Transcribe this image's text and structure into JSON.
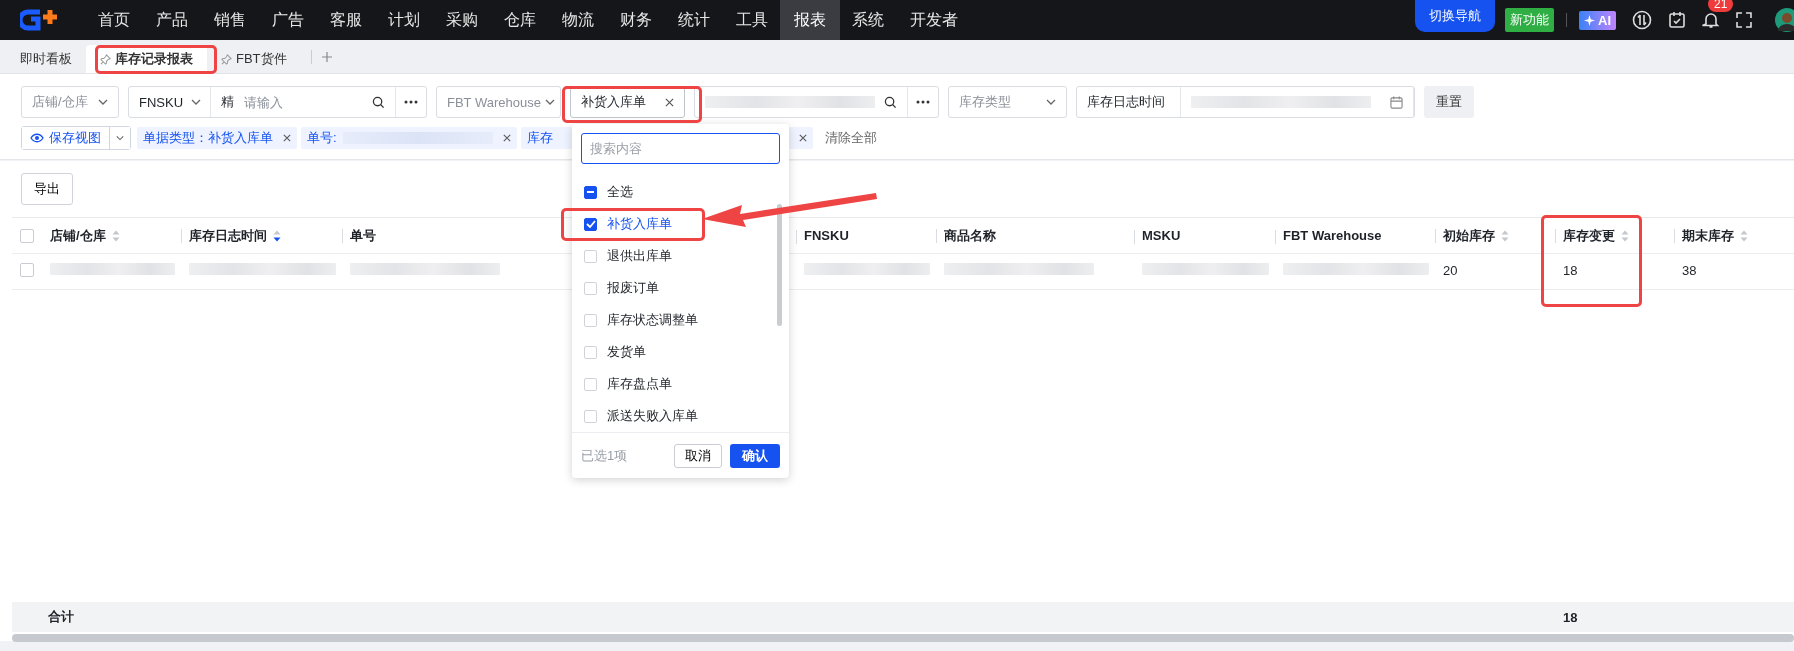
{
  "top_nav": {
    "items": [
      {
        "label": "首页",
        "selected": false
      },
      {
        "label": "产品",
        "selected": false
      },
      {
        "label": "销售",
        "selected": false
      },
      {
        "label": "广告",
        "selected": false
      },
      {
        "label": "客服",
        "selected": false
      },
      {
        "label": "计划",
        "selected": false
      },
      {
        "label": "采购",
        "selected": false
      },
      {
        "label": "仓库",
        "selected": false
      },
      {
        "label": "物流",
        "selected": false
      },
      {
        "label": "财务",
        "selected": false
      },
      {
        "label": "统计",
        "selected": false
      },
      {
        "label": "工具",
        "selected": false
      },
      {
        "label": "报表",
        "selected": true
      },
      {
        "label": "系统",
        "selected": false
      },
      {
        "label": "开发者",
        "selected": false
      }
    ],
    "switch_nav": "切换导航",
    "new_feature": "新功能",
    "ai": "AI",
    "notification_count": "21"
  },
  "tabs": [
    {
      "label": "即时看板",
      "selected": false,
      "pinned": false
    },
    {
      "label": "库存记录报表",
      "selected": true,
      "pinned": true
    },
    {
      "label": "FBT货件",
      "selected": false,
      "pinned": true
    }
  ],
  "filters": {
    "shop_select": {
      "placeholder": "店铺/仓库"
    },
    "fnsku": {
      "field": "FNSKU",
      "mode": "精",
      "placeholder": "请输入"
    },
    "warehouse_select": {
      "placeholder": "FBT Warehouse"
    },
    "doc_type_select": {
      "value": "补货入库单"
    },
    "stock_type_select": {
      "placeholder": "库存类型"
    },
    "date_range": {
      "label": "库存日志时间"
    },
    "reset": "重置"
  },
  "view_bar": {
    "save_view": "保存视图",
    "tags": [
      {
        "label": "单据类型：补货入库单"
      },
      {
        "label": "单号:",
        "redacted": true
      },
      {
        "label": "库存"
      }
    ],
    "clear_all": "清除全部"
  },
  "toolbar": {
    "export": "导出"
  },
  "table": {
    "all_checked": false,
    "columns": [
      {
        "label": "店铺/仓库",
        "sortable": true,
        "sorted_descending": false
      },
      {
        "label": "库存日志时间",
        "sortable": true,
        "sorted_descending": true
      },
      {
        "label": "单号",
        "sortable": false
      },
      {
        "label": "FNSKU",
        "sortable": false
      },
      {
        "label": "商品名称",
        "sortable": false
      },
      {
        "label": "MSKU",
        "sortable": false
      },
      {
        "label": "FBT Warehouse",
        "sortable": false
      },
      {
        "label": "初始库存",
        "sortable": true,
        "sorted_descending": false
      },
      {
        "label": "库存变更",
        "sortable": true,
        "sorted_descending": false
      },
      {
        "label": "期末库存",
        "sortable": true,
        "sorted_descending": false
      }
    ],
    "rows": [
      {
        "checked": false,
        "cells": [
          {
            "kind": "redacted"
          },
          {
            "kind": "redacted"
          },
          {
            "kind": "redacted"
          },
          {
            "kind": "redacted"
          },
          {
            "kind": "redacted"
          },
          {
            "kind": "redacted"
          },
          {
            "kind": "redacted"
          },
          {
            "kind": "text",
            "text": "20"
          },
          {
            "kind": "text",
            "text": "18"
          },
          {
            "kind": "text",
            "text": "38"
          }
        ]
      }
    ],
    "summary": {
      "label": "合计",
      "change_total": "18"
    }
  },
  "dropdown": {
    "search_placeholder": "搜索内容",
    "select_all": {
      "label": "全选",
      "indeterminate": true
    },
    "options": [
      {
        "label": "补货入库单",
        "checked": true
      },
      {
        "label": "退供出库单",
        "checked": false
      },
      {
        "label": "报废订单",
        "checked": false
      },
      {
        "label": "库存状态调整单",
        "checked": false
      },
      {
        "label": "发货单",
        "checked": false
      },
      {
        "label": "库存盘点单",
        "checked": false
      },
      {
        "label": "派送失败入库单",
        "checked": false
      }
    ],
    "selected_count": "已选1项",
    "cancel": "取消",
    "confirm": "确认"
  }
}
